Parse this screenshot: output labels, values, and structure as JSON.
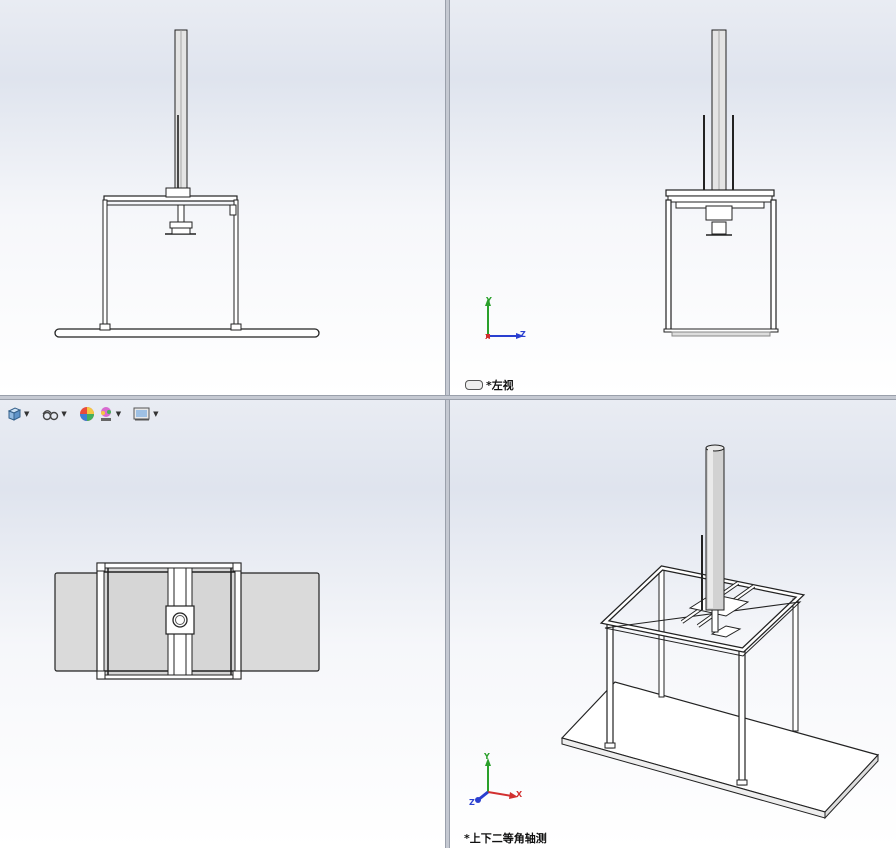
{
  "viewports": {
    "front": {
      "label": ""
    },
    "left": {
      "label": "*左视"
    },
    "top": {
      "label": ""
    },
    "iso": {
      "label": "*上下二等角轴测"
    }
  },
  "triad": {
    "x": "X",
    "y": "Y",
    "z": "Z"
  },
  "view_toolbar": {
    "icons": [
      "display-style-cube-icon",
      "hide-show-items-icon",
      "edit-appearance-icon",
      "apply-scene-icon",
      "view-settings-icon"
    ]
  },
  "colors": {
    "triad_x": "#d23030",
    "triad_y": "#2aa02a",
    "triad_z": "#2a3fd0",
    "edge": "#1a1a1a",
    "shade": "#d8d8d8"
  }
}
